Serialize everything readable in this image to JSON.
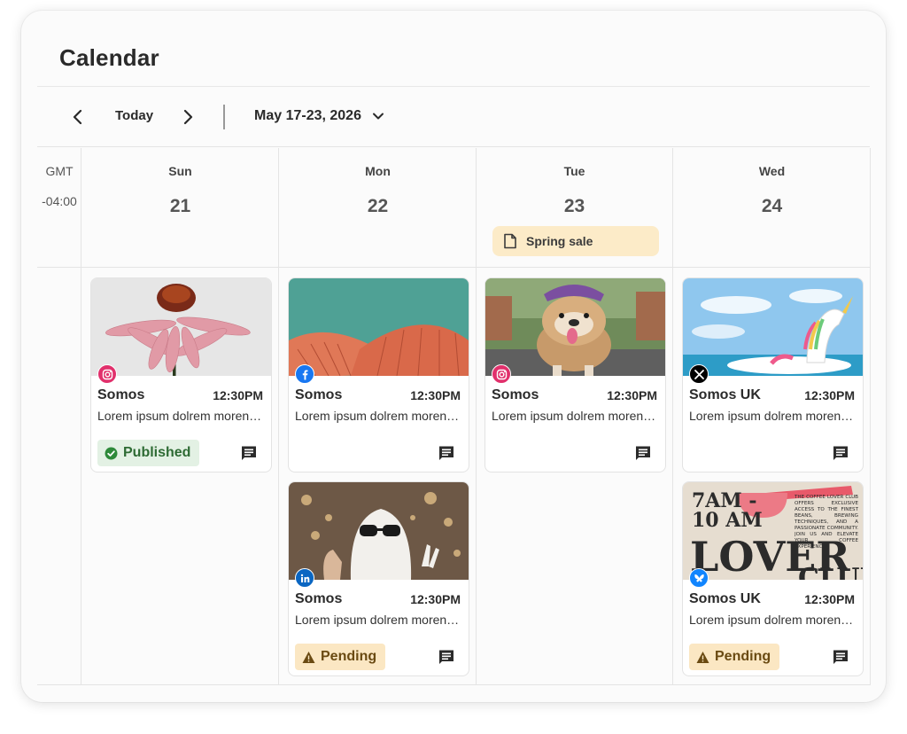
{
  "window": {
    "title": "Calendar"
  },
  "toolbar": {
    "prev_icon": "chevron-left-icon",
    "today_label": "Today",
    "next_icon": "chevron-right-icon",
    "date_range": "May 17-23, 2026",
    "dropdown_icon": "chevron-down-icon"
  },
  "timezone": {
    "line1": "GMT",
    "line2": "-04:00"
  },
  "colors": {
    "accent_event": "#fcebc8",
    "published_bg": "#e3f1e4",
    "published_fg": "#2e6b34",
    "pending_bg": "#fbe7c3",
    "pending_fg": "#6a4a12"
  },
  "days": [
    {
      "dow": "Sun",
      "date": "21"
    },
    {
      "dow": "Mon",
      "date": "22"
    },
    {
      "dow": "Tue",
      "date": "23",
      "event": {
        "label": "Spring sale",
        "icon": "document-icon"
      }
    },
    {
      "dow": "Wed",
      "date": "24"
    }
  ],
  "posts": [
    {
      "day": 0,
      "network": "instagram",
      "account": "Somos",
      "time": "12:30PM",
      "text": "Lorem ipsum dolrem morenatus",
      "status": "Published",
      "image": "pink-flower"
    },
    {
      "day": 1,
      "network": "facebook",
      "account": "Somos",
      "time": "12:30PM",
      "text": "Lorem ipsum dolrem morenatus",
      "status": "",
      "image": "mushroom"
    },
    {
      "day": 1,
      "network": "linkedin",
      "account": "Somos",
      "time": "12:30PM",
      "text": "Lorem ipsum dolrem morenatus",
      "status": "Pending",
      "image": "ghost-costume"
    },
    {
      "day": 2,
      "network": "instagram",
      "account": "Somos",
      "time": "12:30PM",
      "text": "Lorem ipsum dolrem morenatus",
      "status": "",
      "image": "bulldog"
    },
    {
      "day": 3,
      "network": "x",
      "account": "Somos UK",
      "time": "12:30PM",
      "text": "Lorem ipsum dolrem morenatus",
      "status": "",
      "image": "unicorn-float"
    },
    {
      "day": 3,
      "network": "bluesky",
      "account": "Somos UK",
      "time": "12:30PM",
      "text": "Lorem ipsum dolrem morenatus",
      "status": "Pending",
      "image": "coffee-poster",
      "poster": {
        "line1": "7AM -",
        "line2": "10 AM",
        "big": "LOVER",
        "tail": "CLUB",
        "blurb": "THE COFFEE LOVER CLUB OFFERS EXCLUSIVE ACCESS TO THE FINEST BEANS, BREWING TECHNIQUES, AND A PASSIONATE COMMUNITY. JOIN US AND ELEVATE YOUR COFFEE EXPERIENCE"
      }
    }
  ]
}
